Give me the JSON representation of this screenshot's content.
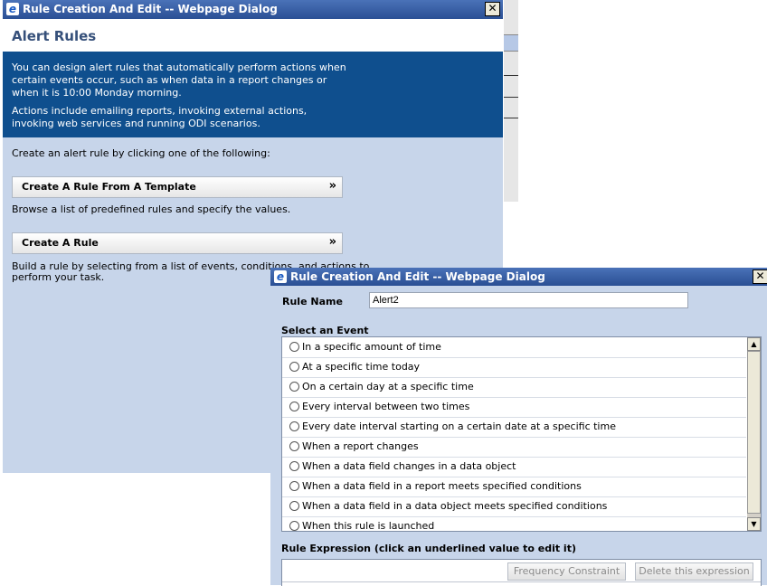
{
  "bg_dialog": {
    "title": "Rule Creation And Edit -- Webpage Dialog",
    "close_glyph": "✕",
    "heading": "Alert Rules",
    "info_p1": "You can design alert rules that automatically perform actions when certain events occur, such as when data in a report changes or when it is 10:00 Monday morning.",
    "info_p2": "Actions include emailing reports, invoking external actions, invoking web services and running ODI scenarios.",
    "instruction": "Create an alert rule by clicking one of the following:",
    "template_button": "Create A Rule From A Template",
    "template_desc": "Browse a list of predefined rules and specify the values.",
    "rule_button": "Create A Rule",
    "rule_desc_1": "Build a rule by selecting from a list of events, conditions, and actions to",
    "rule_desc_2": "perform your task.",
    "chevron": "»"
  },
  "fg_dialog": {
    "title": "Rule Creation And Edit -- Webpage Dialog",
    "close_glyph": "✕",
    "rule_name_label": "Rule Name",
    "rule_name_value": "Alert2",
    "select_event_label": "Select an Event",
    "events": [
      "In a specific amount of time",
      "At a specific time today",
      "On a certain day at a specific time",
      "Every interval between two times",
      "Every date interval starting on a certain date at a specific time",
      "When a report changes",
      "When a data field changes in a data object",
      "When a data field in a report meets specified conditions",
      "When a data field in a data object meets specified conditions",
      "When this rule is launched"
    ],
    "rule_expression_label": "Rule Expression (click an underlined value to edit it)",
    "frequency_button": "Frequency Constraint",
    "delete_button": "Delete this expression"
  },
  "colors": {
    "titlebar": "#2a4f94",
    "dialog_bg": "#c7d5ea",
    "info_bg": "#0f4f8e",
    "heading": "#36507a"
  }
}
